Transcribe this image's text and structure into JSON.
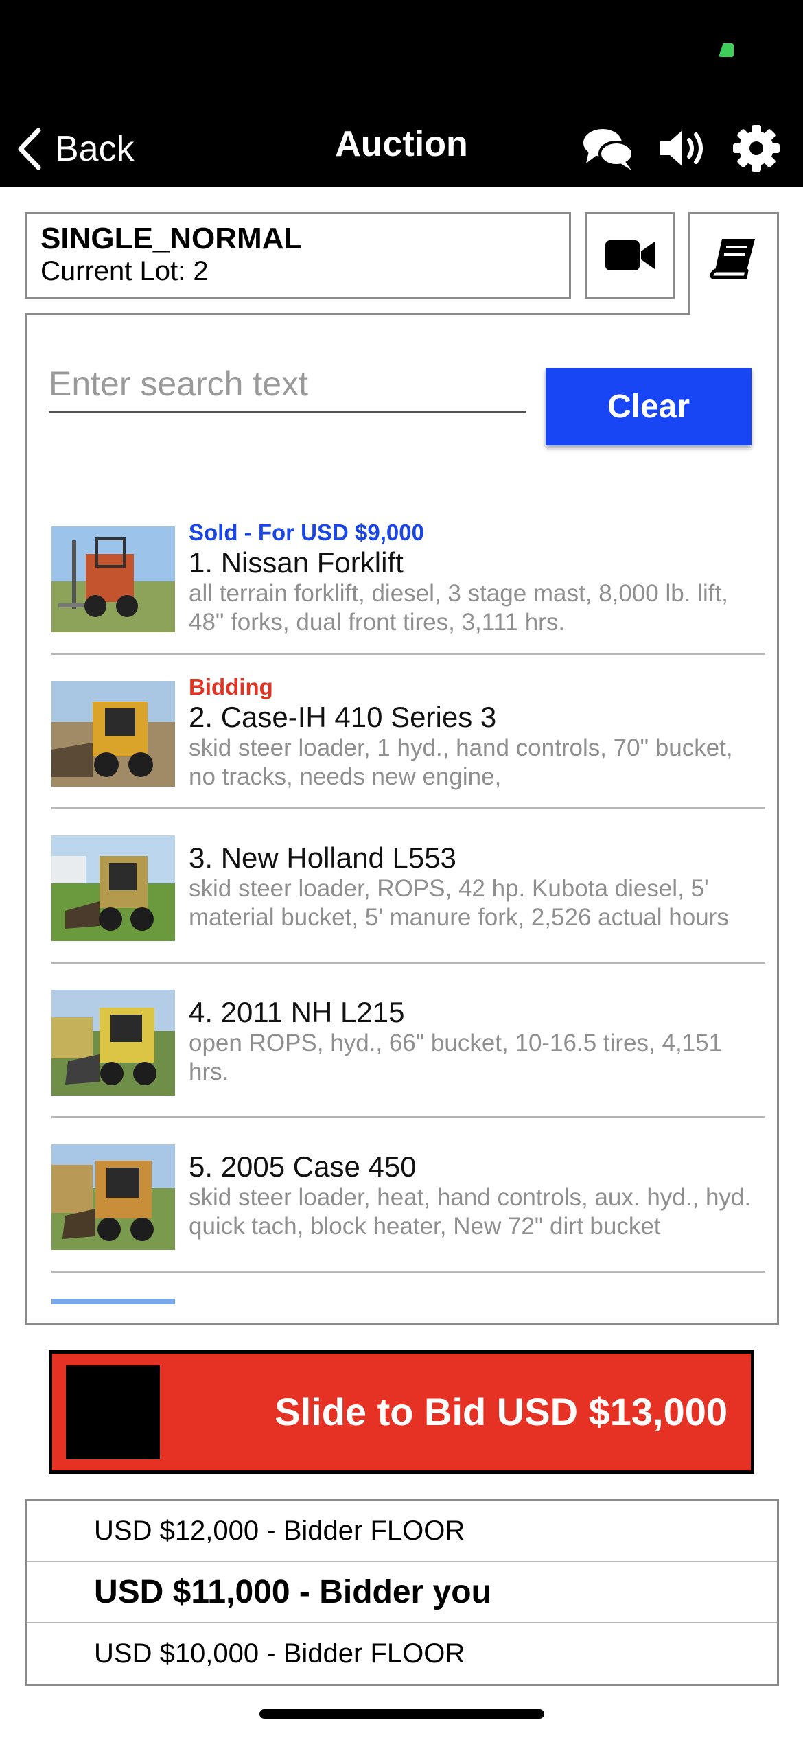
{
  "nav": {
    "back_label": "Back",
    "title": "Auction",
    "icons": [
      "chat-icon",
      "speaker-icon",
      "gear-icon"
    ]
  },
  "header": {
    "auction_name": "SINGLE_NORMAL",
    "current_lot": "Current Lot: 2"
  },
  "tabs": [
    "video-camera-icon",
    "book-icon"
  ],
  "search": {
    "placeholder": "Enter search text",
    "value": "",
    "clear_label": "Clear"
  },
  "lots": [
    {
      "status": "Sold - For USD $9,000",
      "status_color": "#1a46e6",
      "title": "1. Nissan Forklift",
      "description": "all terrain forklift, diesel, 3 stage mast, 8,000 lb. lift, 48\" forks, dual front tires, 3,111 hrs."
    },
    {
      "status": "Bidding",
      "status_color": "#e03424",
      "title": "2. Case-IH 410 Series 3",
      "description": "skid steer loader, 1 hyd., hand controls, 70\" bucket, no tracks, needs new engine,"
    },
    {
      "status": "",
      "status_color": "",
      "title": "3. New Holland L553",
      "description": "skid steer loader, ROPS, 42 hp. Kubota diesel, 5' material bucket, 5' manure fork, 2,526 actual hours"
    },
    {
      "status": "",
      "status_color": "",
      "title": "4. 2011 NH L215",
      "description": "open ROPS, hyd., 66\" bucket, 10-16.5 tires, 4,151 hrs."
    },
    {
      "status": "",
      "status_color": "",
      "title": "5. 2005 Case 450",
      "description": "skid steer loader, heat, hand controls, aux. hyd., hyd. quick tach, block heater, New 72\" dirt bucket"
    }
  ],
  "slide_bid": {
    "label": "Slide to Bid USD $13,000"
  },
  "bid_history": [
    "USD $12,000 - Bidder FLOOR",
    "USD $11,000 - Bidder you",
    "USD $10,000 - Bidder FLOOR"
  ],
  "colors": {
    "accent_blue": "#1946f5",
    "bid_red": "#e53224",
    "status_green": "#3fce5a"
  }
}
